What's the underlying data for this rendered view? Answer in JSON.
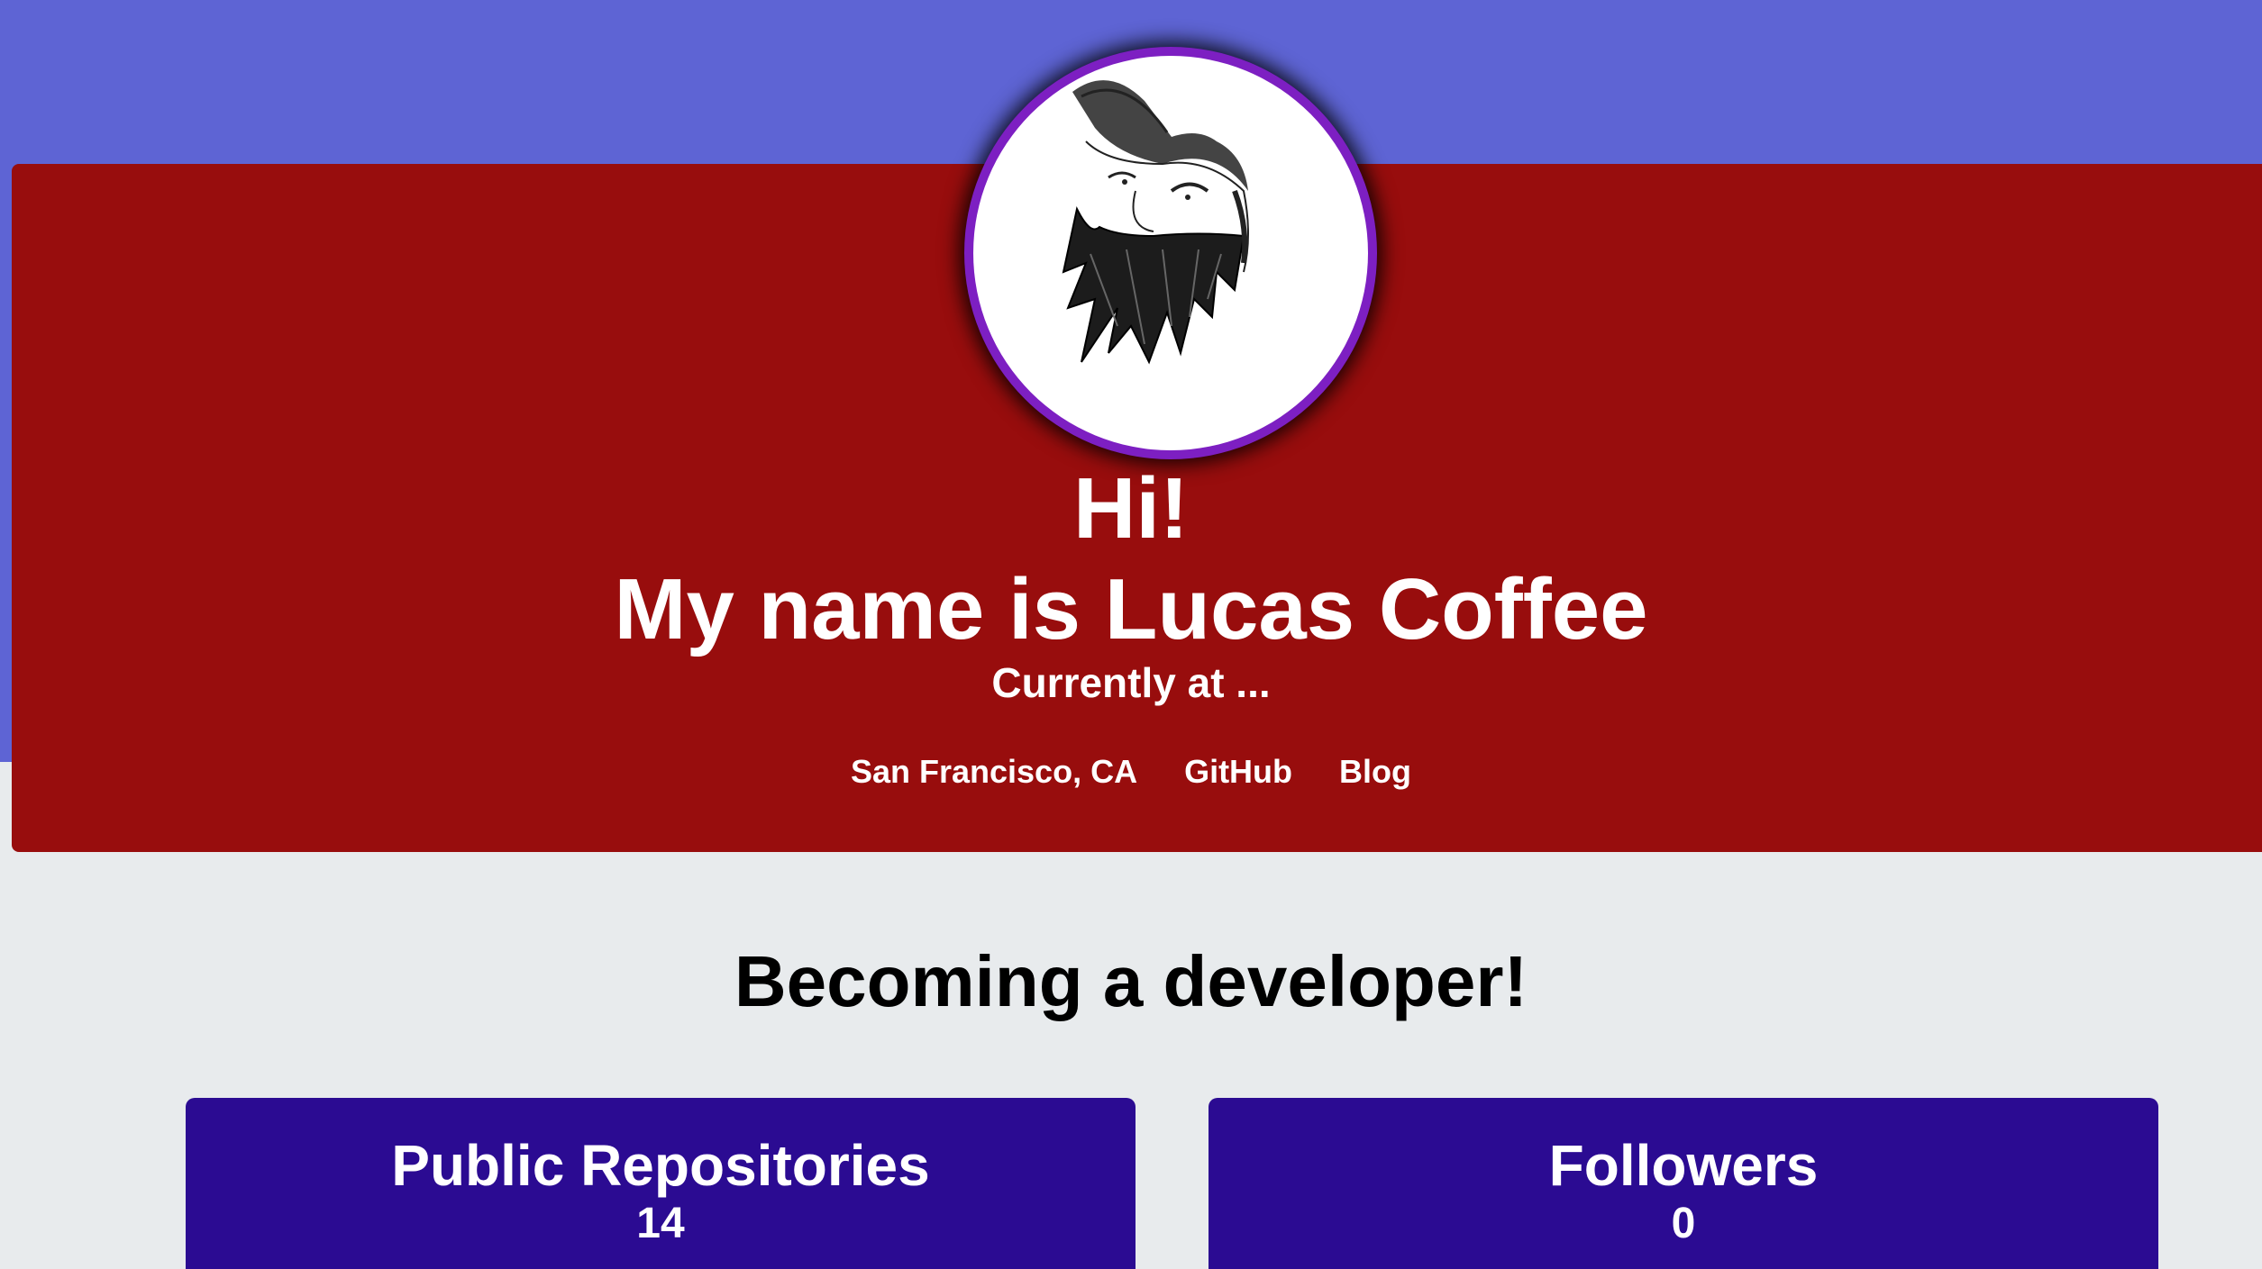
{
  "hero": {
    "greeting": "Hi!",
    "name_line": "My name is Lucas Coffee",
    "current": "Currently at ...",
    "links": [
      {
        "label": "San Francisco, CA"
      },
      {
        "label": "GitHub"
      },
      {
        "label": "Blog"
      }
    ]
  },
  "main": {
    "section_title": "Becoming a developer!",
    "stats": [
      {
        "label": "Public Repositories",
        "value": "14"
      },
      {
        "label": "Followers",
        "value": "0"
      }
    ]
  },
  "colors": {
    "top_band": "#5e64d4",
    "header_card": "#980d0d",
    "avatar_ring": "#7d1fc2",
    "stat_card": "#2b0b92",
    "page_background": "#e8ebed"
  },
  "icons": {
    "avatar": "bearded-man-with-cap-sketch"
  }
}
